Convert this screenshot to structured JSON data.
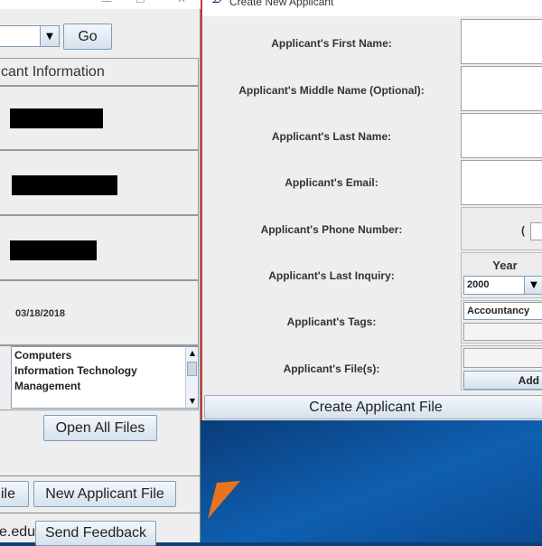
{
  "left": {
    "go_button": "Go",
    "section_header": "cant Information",
    "date": "03/18/2018",
    "tags": [
      "Computers",
      "Information Technology",
      "Management"
    ],
    "open_all_files": "Open All Files",
    "partial_file_button": "ile",
    "new_applicant_file": "New Applicant File",
    "email_suffix": "e.edu)",
    "send_feedback": "Send Feedback"
  },
  "dialog": {
    "title": "Create New Applicant",
    "labels": {
      "first_name": "Applicant's First Name:",
      "middle_name": "Applicant's Middle Name (Optional):",
      "last_name": "Applicant's Last Name:",
      "email": "Applicant's Email:",
      "phone": "Applicant's Phone Number:",
      "last_inquiry": "Applicant's Last Inquiry:",
      "tags": "Applicant's Tags:",
      "files": "Applicant's File(s):"
    },
    "phone_paren": "(",
    "year_label": "Year",
    "year_value": "2000",
    "tag_value": "Accountancy",
    "add_button": "Add",
    "create_button": "Create Applicant File"
  },
  "colors": {
    "dialog_border": "#c23b3b",
    "desktop": "#0d3f7a",
    "accent": "#e8741f"
  }
}
